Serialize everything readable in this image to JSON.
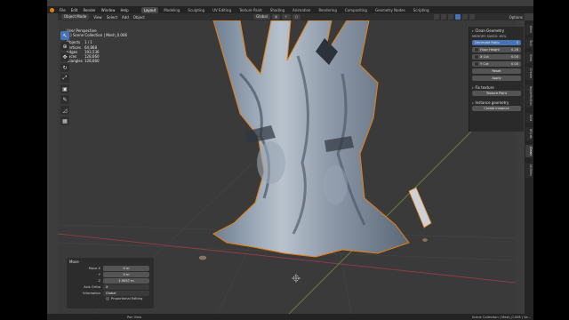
{
  "menu": {
    "items": [
      "File",
      "Edit",
      "Render",
      "Window",
      "Help"
    ],
    "workspaces": [
      "Layout",
      "Modeling",
      "Sculpting",
      "UV Editing",
      "Texture Paint",
      "Shading",
      "Animation",
      "Rendering",
      "Compositing",
      "Geometry Nodes",
      "Scripting"
    ],
    "active_workspace": "Layout"
  },
  "header": {
    "mode": "Object Mode",
    "menus": [
      "View",
      "Select",
      "Add",
      "Object"
    ],
    "transform": "Global",
    "options": "Options"
  },
  "viewport": {
    "title": "User Perspective",
    "collection": "(1) Scene Collection | Mesh_0.006",
    "stats": [
      {
        "k": "Objects",
        "v": "1 / 1"
      },
      {
        "k": "Vertices",
        "v": "64,868"
      },
      {
        "k": "Edges",
        "v": "193,536"
      },
      {
        "k": "Faces",
        "v": "128,660"
      },
      {
        "k": "Triangles",
        "v": "128,660"
      }
    ]
  },
  "npanel": {
    "clean_geometry": "Clean Geometry",
    "memory": "MEMORY SAVED: 60%",
    "decimate_ratio_label": "Decimate Ratio",
    "decimate_ratio_value": "0",
    "floor_height_label": "Floor Height",
    "floor_height_value": "0.28",
    "x_cut_label": "X Cut",
    "x_cut_value": "0.00",
    "y_cut_label": "Y Cut",
    "y_cut_value": "0.00",
    "reset": "Reset",
    "apply": "Apply",
    "fix_texture": "Fix texture",
    "texture_paint": "Texture Paint",
    "instance_geometry": "Instance geometry",
    "create_instance": "Create instance"
  },
  "tabs": [
    "Item",
    "Tool",
    "View",
    "Create",
    "Imperfection",
    "Grid",
    "BRLab",
    "Clean",
    "Utilities"
  ],
  "operator": {
    "title": "Move",
    "move_x_label": "Move X",
    "move_x": "0 m",
    "y_label": "Y",
    "y": "0 m",
    "z_label": "Z",
    "z": "1.9057 m",
    "axis_ortho_label": "Axis Ortho",
    "axis_ortho": "X",
    "orientation_label": "Orientation",
    "orientation": "Global",
    "proportional": "Proportional Editing"
  },
  "status": {
    "left": "Pan View",
    "right": "Scene Collection | Mesh_0.006 | Ve..."
  },
  "colors": {
    "accent": "#4772b3",
    "selection": "#e87d0d",
    "grid_x": "#a03a4a",
    "grid_y": "#7a9a2a"
  }
}
